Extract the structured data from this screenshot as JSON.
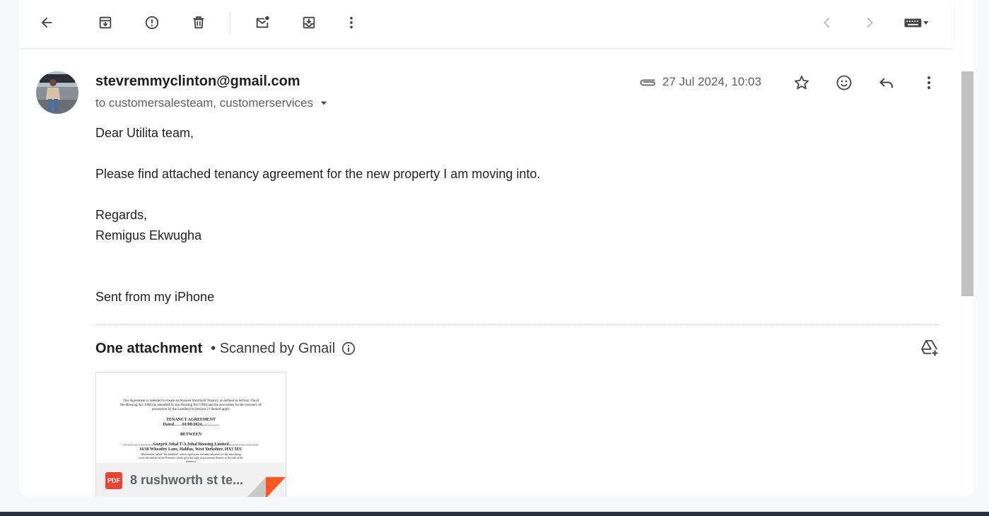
{
  "toolbar": {
    "left_actions": [
      {
        "name": "back",
        "icon": "arrow-left-icon"
      },
      {
        "name": "archive",
        "icon": "archive-icon"
      },
      {
        "name": "report-spam",
        "icon": "report-spam-icon"
      },
      {
        "name": "delete",
        "icon": "trash-icon"
      },
      {
        "name": "mark-unread",
        "icon": "mark-unread-icon"
      },
      {
        "name": "move-to",
        "icon": "move-to-inbox-icon"
      },
      {
        "name": "more",
        "icon": "more-vert-icon"
      }
    ],
    "right_actions": [
      {
        "name": "newer",
        "icon": "chevron-left-icon"
      },
      {
        "name": "older",
        "icon": "chevron-right-icon"
      },
      {
        "name": "input-tools",
        "icon": "keyboard-icon"
      }
    ],
    "cut_off_text": "...., ..."
  },
  "email": {
    "sender": "stevremmyclinton@gmail.com",
    "recipients": "to customersalesteam, customerservices",
    "date": "27 Jul 2024, 10:03",
    "body": {
      "greeting": "Dear Utilita team,",
      "paragraph": "Please find attached tenancy agreement for the new property I am moving into.",
      "signoff": "Regards,",
      "name": "Remigus Ekwugha",
      "signature": "Sent from my iPhone"
    }
  },
  "attachments": {
    "count_label": "One attachment",
    "scanned_label": "• Scanned by Gmail",
    "items": [
      {
        "filename": "8 rushworth st te...",
        "type_badge": "PDF",
        "preview": {
          "intro": "This Agreement is intended to create an Assured Shorthold Tenancy as defined in Section 19a of the Housing Act 1988 (as amended by the Housing Act 1996) and the provisions for the recovery of possession by the Landlord in Section 21 thereof apply",
          "title": "TENANCY AGREEMENT",
          "dated": "Dated……01/08/2024…………",
          "between": "BETWEEN",
          "party": "…………………Gurprit Johal T/A Johal Housing Limited…………………",
          "address": "16/18 Wheatley Lane, Halifax, West Yorkshire, HX3 5EU",
          "small": "(Hereinafter called \"the landlord\" which expression included whoever for the time being owns the interest in the Premises which give the right of possession thereof in the title of the tenancy)"
        }
      }
    ]
  },
  "colors": {
    "page_bg": "#f6f8fc",
    "card_bg": "#ffffff",
    "pdf_red": "#ea4335",
    "fold_orange": "#ff5722"
  }
}
